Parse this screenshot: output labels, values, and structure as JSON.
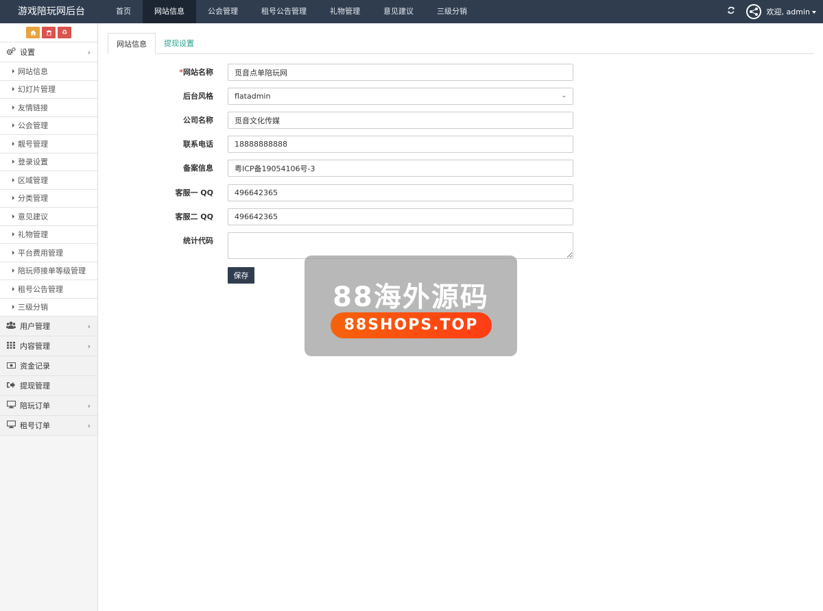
{
  "header": {
    "brand": "游戏陪玩网后台",
    "nav": [
      {
        "label": "首页",
        "active": false
      },
      {
        "label": "网站信息",
        "active": true
      },
      {
        "label": "公会管理",
        "active": false
      },
      {
        "label": "租号公告管理",
        "active": false
      },
      {
        "label": "礼物管理",
        "active": false
      },
      {
        "label": "意见建议",
        "active": false
      },
      {
        "label": "三级分销",
        "active": false
      }
    ],
    "welcome": "欢迎, admin"
  },
  "sidebar": {
    "settings_label": "设置",
    "settings_items": [
      "网站信息",
      "幻灯片管理",
      "友情链接",
      "公会管理",
      "靓号管理",
      "登录设置",
      "区域管理",
      "分类管理",
      "意见建议",
      "礼物管理",
      "平台费用管理",
      "陪玩师接单等级管理",
      "租号公告管理",
      "三级分销"
    ],
    "groups": [
      {
        "label": "用户管理",
        "icon": "users-icon",
        "has_arrow": true
      },
      {
        "label": "内容管理",
        "icon": "grid-icon",
        "has_arrow": true
      },
      {
        "label": "资金记录",
        "icon": "money-icon",
        "has_arrow": false
      },
      {
        "label": "提现管理",
        "icon": "sign-out-icon",
        "has_arrow": false
      },
      {
        "label": "陪玩订单",
        "icon": "monitor-icon",
        "has_arrow": true
      },
      {
        "label": "租号订单",
        "icon": "monitor-icon",
        "has_arrow": true
      }
    ]
  },
  "tabs": [
    {
      "label": "网站信息",
      "active": true
    },
    {
      "label": "提现设置",
      "active": false
    }
  ],
  "form": {
    "site_name": {
      "label": "网站名称",
      "value": "觅音点单陪玩网",
      "required": true
    },
    "admin_style": {
      "label": "后台风格",
      "value": "flatadmin"
    },
    "company_name": {
      "label": "公司名称",
      "value": "觅音文化传媒"
    },
    "phone": {
      "label": "联系电话",
      "value": "18888888888"
    },
    "icp": {
      "label": "备案信息",
      "value": "粤ICP备19054106号-3"
    },
    "qq1": {
      "label": "客服一 QQ",
      "value": "496642365"
    },
    "qq2": {
      "label": "客服二 QQ",
      "value": "496642365"
    },
    "stats_code": {
      "label": "统计代码",
      "value": ""
    },
    "save_label": "保存"
  },
  "watermark": {
    "title": "88海外源码",
    "url": "88SHOPS.TOP"
  },
  "colors": {
    "topbar": "#2f3d4f",
    "accent_green": "#2aa08a",
    "home_btn": "#e8a33d",
    "danger_btn": "#d9534f"
  }
}
